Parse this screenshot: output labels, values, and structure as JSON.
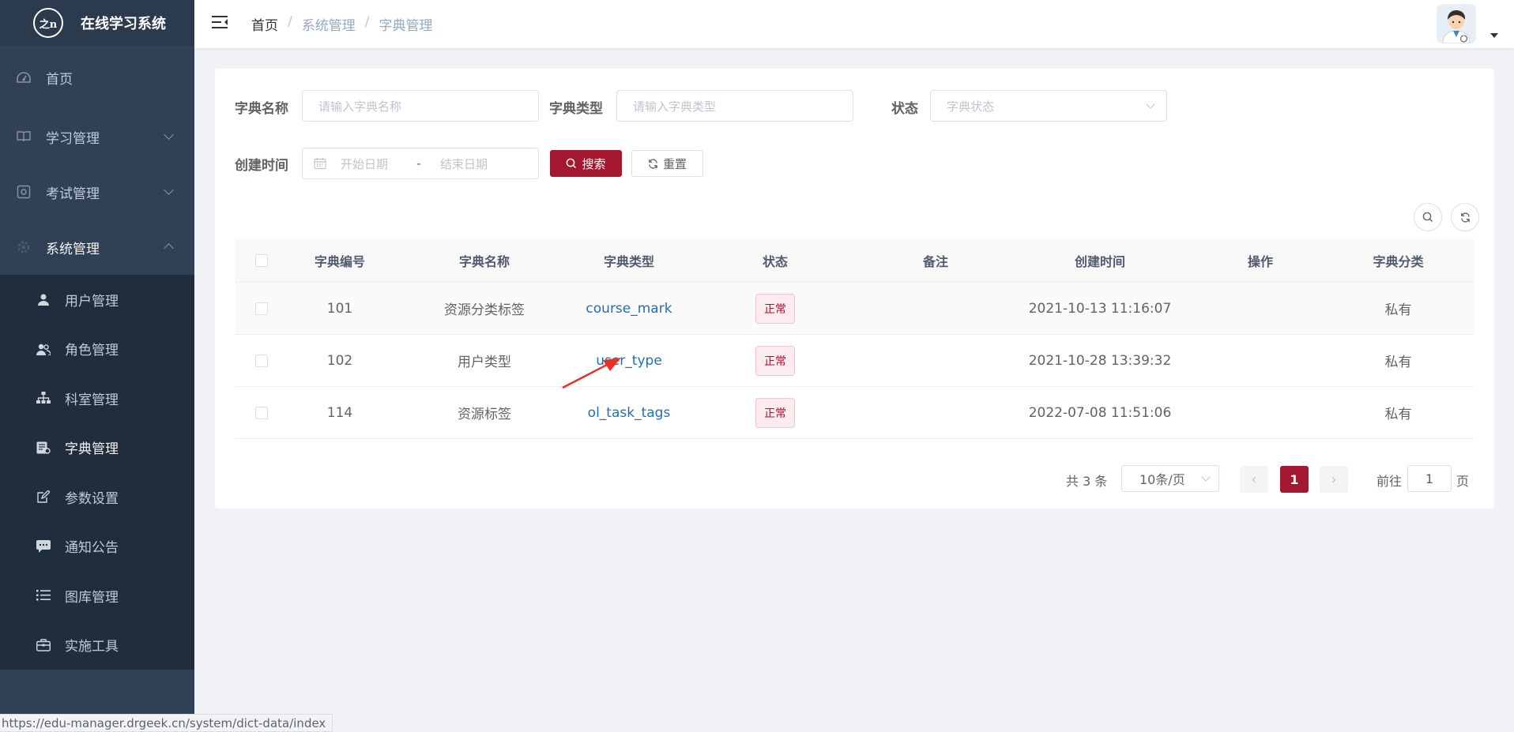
{
  "app": {
    "logo_mark": "之n",
    "title": "在线学习系统"
  },
  "sidebar": {
    "items": [
      {
        "label": "首页",
        "icon": "dashboard-icon"
      },
      {
        "label": "学习管理",
        "icon": "book-icon"
      },
      {
        "label": "考试管理",
        "icon": "exam-icon"
      },
      {
        "label": "系统管理",
        "icon": "gear-icon"
      }
    ],
    "sub_items": [
      {
        "label": "用户管理",
        "icon": "user-icon"
      },
      {
        "label": "角色管理",
        "icon": "users-icon"
      },
      {
        "label": "科室管理",
        "icon": "tree-icon"
      },
      {
        "label": "字典管理",
        "icon": "dict-icon",
        "active": true
      },
      {
        "label": "参数设置",
        "icon": "edit-icon"
      },
      {
        "label": "通知公告",
        "icon": "message-icon"
      },
      {
        "label": "图库管理",
        "icon": "list-icon"
      },
      {
        "label": "实施工具",
        "icon": "toolbox-icon"
      }
    ]
  },
  "breadcrumb": {
    "home": "首页",
    "sep": "/",
    "level1": "系统管理",
    "level2": "字典管理"
  },
  "search": {
    "dict_name_label": "字典名称",
    "dict_name_placeholder": "请输入字典名称",
    "dict_type_label": "字典类型",
    "dict_type_placeholder": "请输入字典类型",
    "status_label": "状态",
    "status_placeholder": "字典状态",
    "create_time_label": "创建时间",
    "start_placeholder": "开始日期",
    "range_sep": "-",
    "end_placeholder": "结束日期",
    "search_button": "搜索",
    "reset_button": "重置"
  },
  "table": {
    "headers": [
      "字典编号",
      "字典名称",
      "字典类型",
      "状态",
      "备注",
      "创建时间",
      "操作",
      "字典分类"
    ],
    "rows": [
      {
        "id": "101",
        "name": "资源分类标签",
        "type": "course_mark",
        "status": "正常",
        "remark": "",
        "created": "2021-10-13 11:16:07",
        "category": "私有"
      },
      {
        "id": "102",
        "name": "用户类型",
        "type": "user_type",
        "status": "正常",
        "remark": "",
        "created": "2021-10-28 13:39:32",
        "category": "私有"
      },
      {
        "id": "114",
        "name": "资源标签",
        "type": "ol_task_tags",
        "status": "正常",
        "remark": "",
        "created": "2022-07-08 11:51:06",
        "category": "私有"
      }
    ]
  },
  "pagination": {
    "total": "共 3 条",
    "page_size": "10条/页",
    "prev": "‹",
    "current": "1",
    "next": "›",
    "goto_label": "前往",
    "goto_value": "1",
    "page_suffix": "页"
  },
  "status_url": "https://edu-manager.drgeek.cn/system/dict-data/index",
  "colors": {
    "sidebar_bg": "#304156",
    "primary": "#a3182e",
    "link": "#1f6fb5",
    "annotation_arrow": "#e8302a"
  }
}
